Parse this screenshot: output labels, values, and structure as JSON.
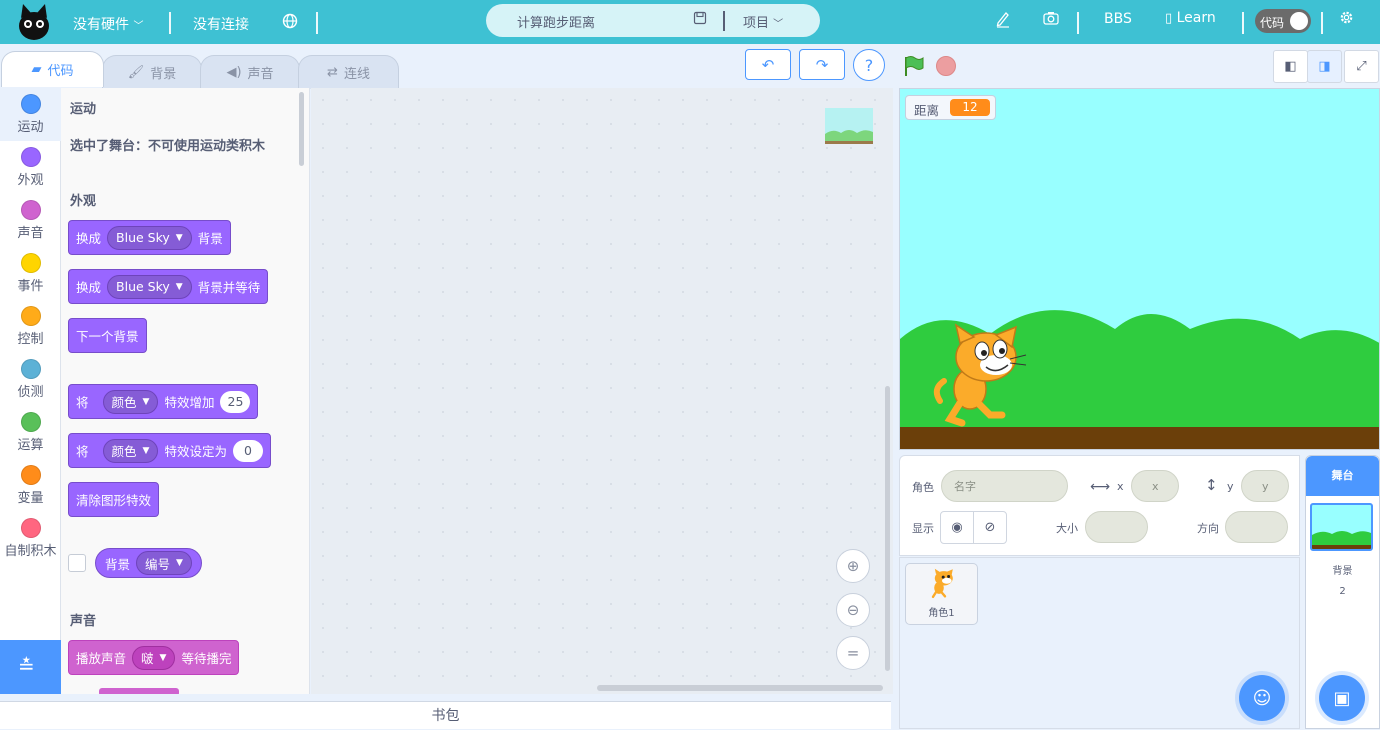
{
  "topbar": {
    "hardware": "没有硬件",
    "connection": "没有连接",
    "project_title": "计算跑步距离",
    "project_menu": "项目",
    "bbs": "BBS",
    "learn": "Learn",
    "code_toggle": "代码"
  },
  "tabs": {
    "code": "代码",
    "backdrops": "背景",
    "sounds": "声音",
    "connect": "连线"
  },
  "categories": [
    {
      "label": "运动",
      "color": "#4c97ff"
    },
    {
      "label": "外观",
      "color": "#9966ff"
    },
    {
      "label": "声音",
      "color": "#cf63cf"
    },
    {
      "label": "事件",
      "color": "#ffd500"
    },
    {
      "label": "控制",
      "color": "#ffab19"
    },
    {
      "label": "侦测",
      "color": "#5cb1d6"
    },
    {
      "label": "运算",
      "color": "#59c059"
    },
    {
      "label": "变量",
      "color": "#ff8c1a"
    },
    {
      "label": "自制积木",
      "color": "#ff6680"
    }
  ],
  "palette": {
    "motion_title": "运动",
    "motion_note": "选中了舞台：不可使用运动类积木",
    "looks_title": "外观",
    "b1": {
      "a": "换成",
      "menu": "Blue Sky",
      "b": "背景"
    },
    "b2": {
      "a": "换成",
      "menu": "Blue Sky",
      "b": "背景并等待"
    },
    "b3": "下一个背景",
    "b4": {
      "a": "将",
      "menu": "颜色",
      "b": "特效增加",
      "value": "25"
    },
    "b5": {
      "a": "将",
      "menu": "颜色",
      "b": "特效设定为",
      "value": "0"
    },
    "b6": "清除图形特效",
    "b7": {
      "a": "背景",
      "menu": "编号"
    },
    "sound_title": "声音",
    "b8": {
      "a": "播放声音",
      "menu": "啵",
      "b": "等待播完"
    }
  },
  "backpack": "书包",
  "monitor": {
    "label": "距离",
    "value": "12"
  },
  "sprite_info": {
    "sprite_label": "角色",
    "name_placeholder": "名字",
    "x_label": "x",
    "x_placeholder": "x",
    "y_label": "y",
    "y_placeholder": "y",
    "show_label": "显示",
    "size_label": "大小",
    "direction_label": "方向"
  },
  "sprites": [
    {
      "name": "角色1"
    }
  ],
  "stage_pane": {
    "title": "舞台",
    "backdrops_label": "背景",
    "backdrops_count": "2"
  },
  "colors": {
    "accent": "#4c97ff",
    "topbar": "#3ec1d3",
    "looks": "#9966ff",
    "sound": "#cf63cf",
    "variable": "#ff8c1a"
  }
}
